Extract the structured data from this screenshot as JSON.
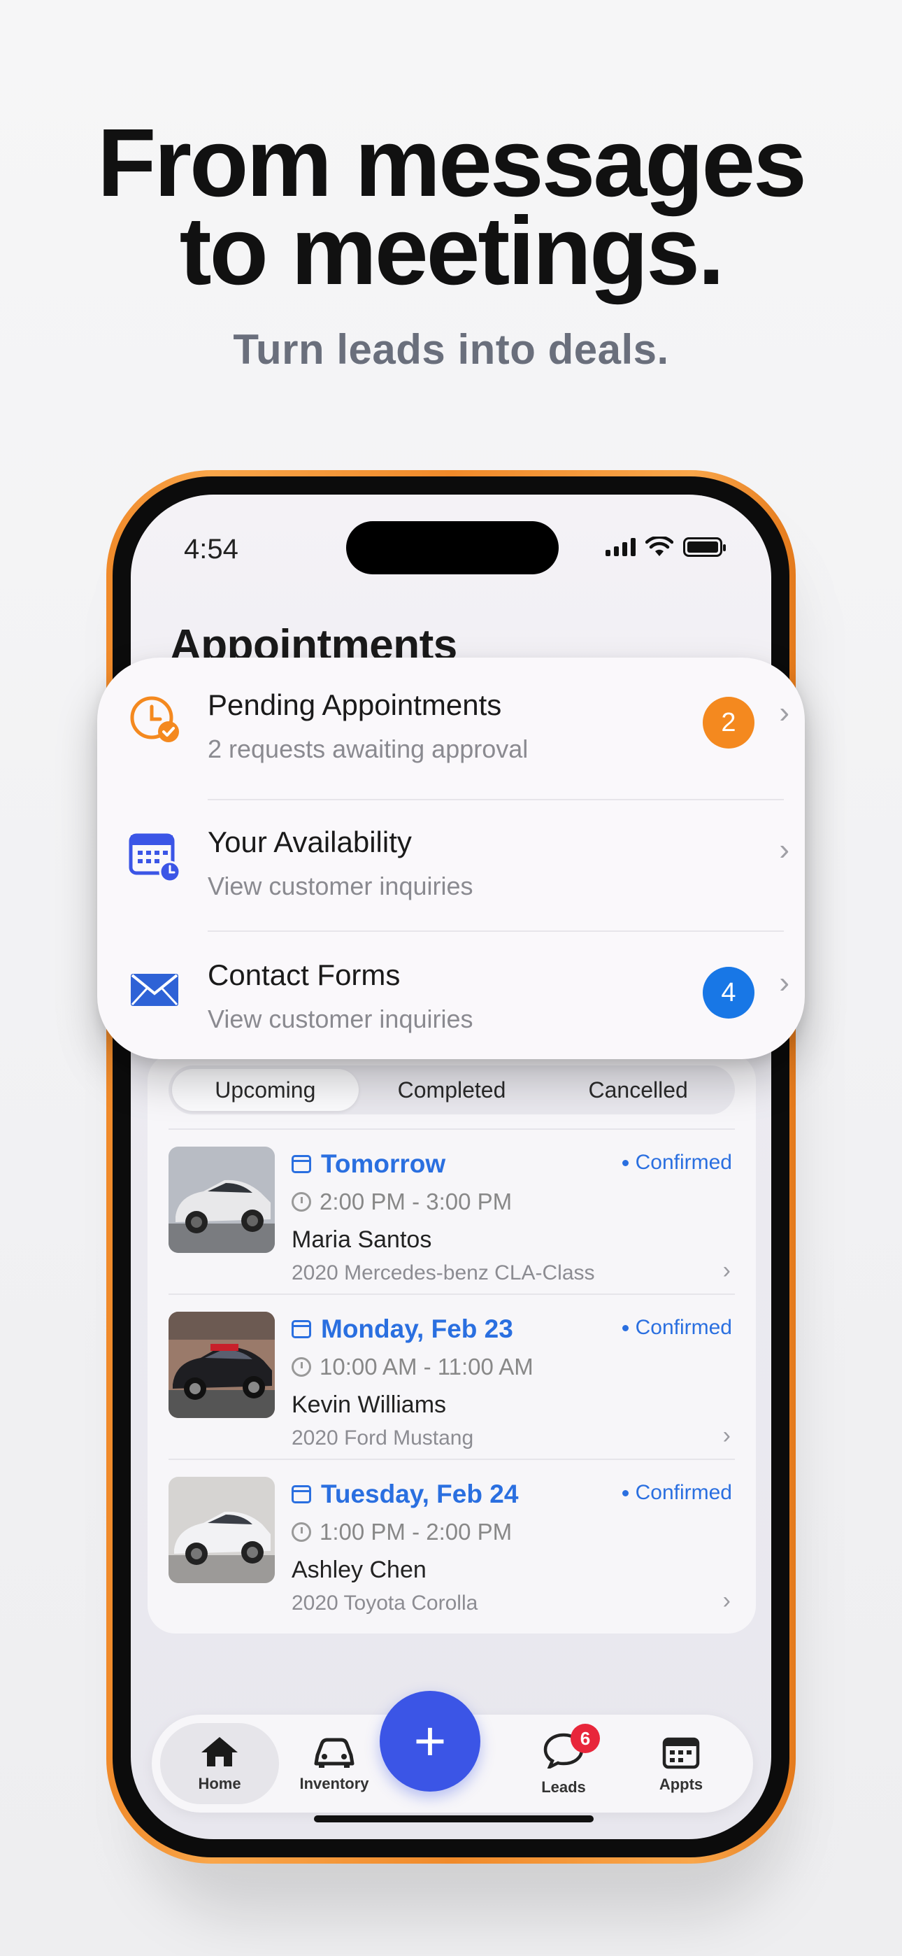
{
  "hero": {
    "headline_line1": "From messages",
    "headline_line2": "to meetings.",
    "subhead": "Turn leads into deals."
  },
  "status_bar": {
    "time": "4:54"
  },
  "screen": {
    "title": "Appointments"
  },
  "summary_card": {
    "items": [
      {
        "title": "Pending Appointments",
        "subtitle": "2 requests awaiting approval",
        "count": "2",
        "count_color": "#f4891f",
        "icon": "clock-check-icon"
      },
      {
        "title": "Your Availability",
        "subtitle": "View customer inquiries",
        "count": "",
        "icon": "calendar-clock-icon"
      },
      {
        "title": "Contact Forms",
        "subtitle": "View customer inquiries",
        "count": "4",
        "count_color": "#1877e6",
        "icon": "envelope-icon"
      }
    ]
  },
  "segments": {
    "items": [
      "Upcoming",
      "Completed",
      "Cancelled"
    ],
    "active": "Upcoming"
  },
  "appointments": [
    {
      "day": "Tomorrow",
      "status": "Confirmed",
      "time": "2:00 PM - 3:00 PM",
      "name": "Maria Santos",
      "vehicle": "2020 Mercedes-benz CLA-Class",
      "car_color": "#e8e8ea"
    },
    {
      "day": "Monday, Feb 23",
      "status": "Confirmed",
      "time": "10:00 AM - 11:00 AM",
      "name": "Kevin Williams",
      "vehicle": "2020 Ford Mustang",
      "car_color": "#1e1e22"
    },
    {
      "day": "Tuesday, Feb 24",
      "status": "Confirmed",
      "time": "1:00 PM - 2:00 PM",
      "name": "Ashley Chen",
      "vehicle": "2020 Toyota Corolla",
      "car_color": "#f0f0f2"
    }
  ],
  "tabbar": {
    "home": "Home",
    "inventory": "Inventory",
    "add": "+",
    "leads": "Leads",
    "leads_badge": "6",
    "appts": "Appts"
  },
  "colors": {
    "accent_blue": "#2a6fe0",
    "fab_blue": "#3b55e6",
    "phone_frame": "#f08a2a"
  }
}
